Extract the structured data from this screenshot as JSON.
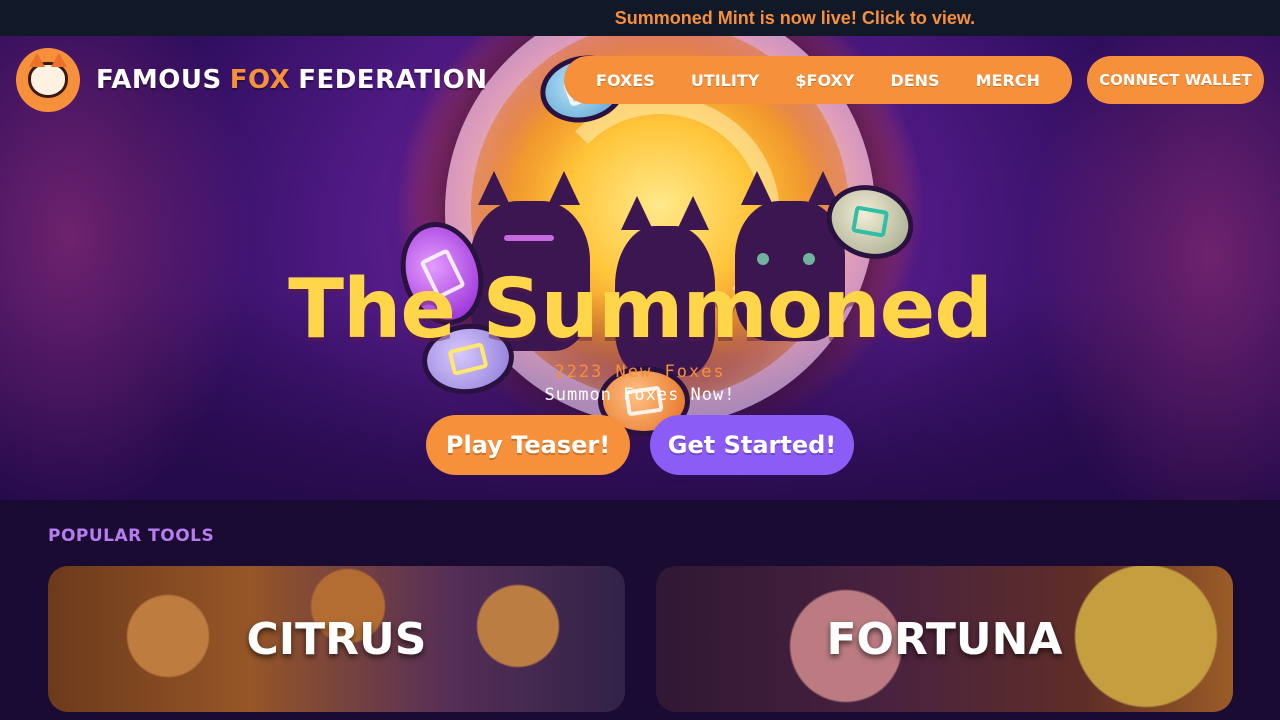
{
  "announcement": {
    "text": "Summoned Mint is now live! Click to view."
  },
  "header": {
    "brand_part1": "FAMOUS",
    "brand_accent": "FOX",
    "brand_part2": "FEDERATION",
    "logo_icon": "fox-logo-icon",
    "nav": [
      {
        "label": "FOXES"
      },
      {
        "label": "UTILITY"
      },
      {
        "label": "$FOXY"
      },
      {
        "label": "DENS"
      },
      {
        "label": "MERCH"
      }
    ],
    "wallet_label": "CONNECT WALLET"
  },
  "hero": {
    "title": "The Summoned",
    "count_text": "2223 New Foxes",
    "subtitle": "Summon Foxes Now!",
    "teaser_label": "Play Teaser!",
    "start_label": "Get Started!"
  },
  "tools": {
    "section_label": "POPULAR TOOLS",
    "cards": [
      {
        "title": "CITRUS"
      },
      {
        "title": "FORTUNA"
      }
    ]
  },
  "colors": {
    "accent_orange": "#f6903a",
    "accent_purple": "#8b5cf6",
    "title_yellow": "#ffd64a",
    "announcement_bg": "#111827",
    "page_bg": "#1a0b33",
    "section_label": "#b67cf0"
  }
}
